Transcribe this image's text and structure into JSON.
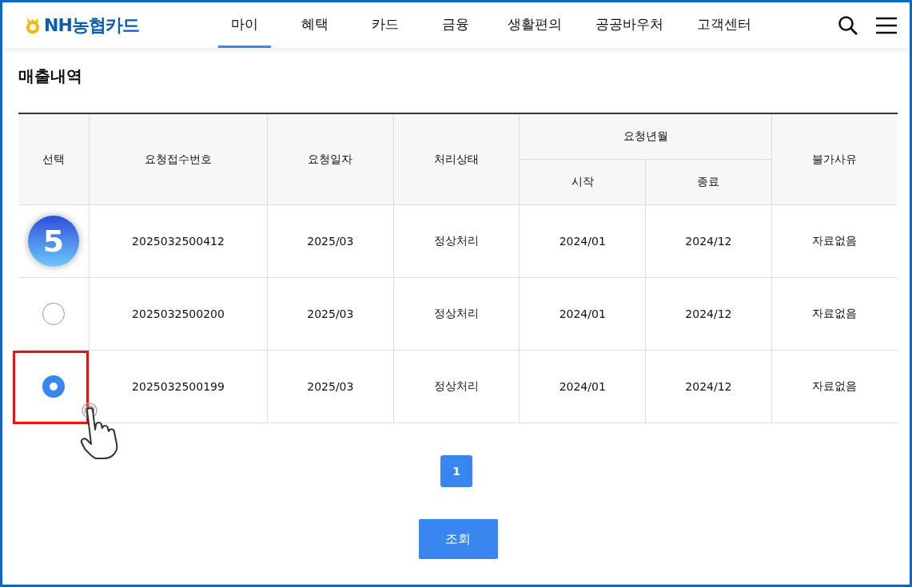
{
  "header": {
    "logo": "NH농협카드",
    "nav": [
      {
        "label": "마이",
        "selected": true
      },
      {
        "label": "혜택",
        "selected": false
      },
      {
        "label": "카드",
        "selected": false
      },
      {
        "label": "금융",
        "selected": false
      },
      {
        "label": "생활편의",
        "selected": false
      },
      {
        "label": "공공바우처",
        "selected": false
      },
      {
        "label": "고객센터",
        "selected": false
      }
    ]
  },
  "page_title": "매출내역",
  "table": {
    "columns": {
      "select": "선택",
      "request_no": "요청접수번호",
      "request_date": "요청일자",
      "status": "처리상태",
      "period": "요청년월",
      "start": "시작",
      "end": "종료",
      "reason": "불가사유"
    },
    "rows": [
      {
        "step_badge": "5",
        "highlighted": false,
        "request_no": "2025032500412",
        "request_date": "2025/03",
        "status": "정상처리",
        "start": "2024/01",
        "end": "2024/12",
        "reason": "자료없음"
      },
      {
        "selected": false,
        "highlighted": false,
        "request_no": "2025032500200",
        "request_date": "2025/03",
        "status": "정상처리",
        "start": "2024/01",
        "end": "2024/12",
        "reason": "자료없음"
      },
      {
        "selected": true,
        "highlighted": true,
        "request_no": "2025032500199",
        "request_date": "2025/03",
        "status": "정상처리",
        "start": "2024/01",
        "end": "2024/12",
        "reason": "자료없음"
      }
    ]
  },
  "pagination": [
    {
      "label": "1",
      "selected": true
    }
  ],
  "search_button": "조회"
}
